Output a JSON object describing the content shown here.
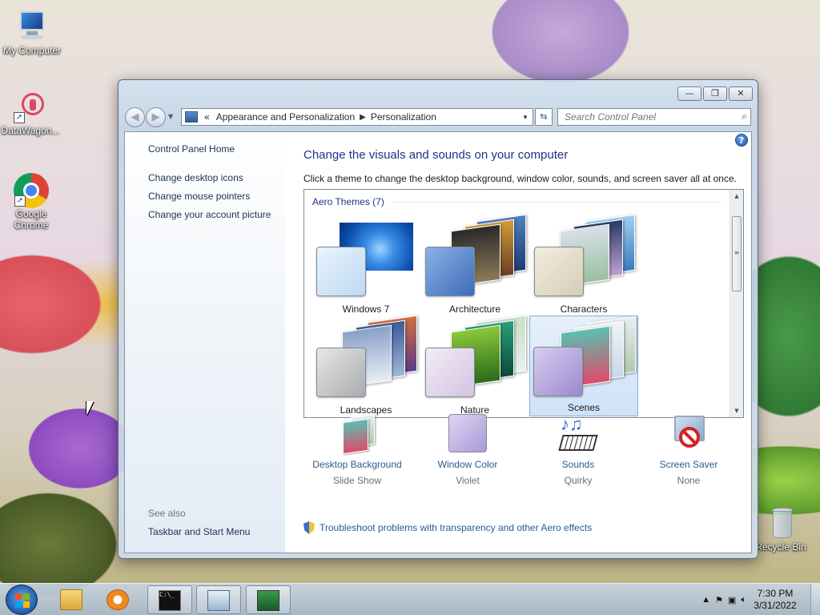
{
  "desktop": {
    "icons": [
      {
        "label": "My Computer",
        "icon": "computer-icon"
      },
      {
        "label": "DataWagon...",
        "icon": "datawagon-icon"
      },
      {
        "label": "Google Chrome",
        "icon": "chrome-icon"
      },
      {
        "label": "Recycle Bin",
        "icon": "recycle-bin-icon"
      }
    ]
  },
  "window": {
    "address": {
      "prefix": "«",
      "crumbs": [
        "Appearance and Personalization",
        "Personalization"
      ]
    },
    "search_placeholder": "Search Control Panel",
    "left_pane": {
      "home": "Control Panel Home",
      "links": [
        "Change desktop icons",
        "Change mouse pointers",
        "Change your account picture"
      ],
      "see_also_header": "See also",
      "see_also": [
        "Taskbar and Start Menu"
      ]
    },
    "title": "Change the visuals and sounds on your computer",
    "subtitle": "Click a theme to change the desktop background, window color, sounds, and screen saver all at once.",
    "group_header": "Aero Themes (7)",
    "themes": [
      {
        "name": "Windows 7",
        "swatch": "#cfe4f7"
      },
      {
        "name": "Architecture",
        "swatch": "#5d8ac8"
      },
      {
        "name": "Characters",
        "swatch": "#e9e1cf"
      },
      {
        "name": "Landscapes",
        "swatch": "#c9cacb"
      },
      {
        "name": "Nature",
        "swatch": "#e3d6ea"
      },
      {
        "name": "Scenes",
        "swatch": "#b5a6d8",
        "selected": true
      }
    ],
    "bottom": [
      {
        "title": "Desktop Background",
        "value": "Slide Show"
      },
      {
        "title": "Window Color",
        "value": "Violet"
      },
      {
        "title": "Sounds",
        "value": "Quirky"
      },
      {
        "title": "Screen Saver",
        "value": "None"
      }
    ],
    "troubleshoot": "Troubleshoot problems with transparency and other Aero effects"
  },
  "taskbar": {
    "time": "7:30 PM",
    "date": "3/31/2022"
  }
}
